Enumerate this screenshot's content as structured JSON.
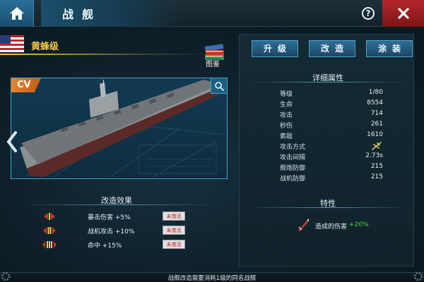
{
  "header": {
    "title": "战舰"
  },
  "ship": {
    "name": "黄蜂级",
    "class_badge": "CV",
    "catalog_label": "图鉴"
  },
  "modification": {
    "title": "改造效果",
    "rows": [
      {
        "icon": "rank-1-icon",
        "text": "暴击伤害  +5%",
        "status": "未激活"
      },
      {
        "icon": "rank-2-icon",
        "text": "战机攻击  +10%",
        "status": "未激活"
      },
      {
        "icon": "rank-3-icon",
        "text": "命中  +15%",
        "status": "未激活"
      }
    ]
  },
  "actions": {
    "upgrade": "升级",
    "modify": "改造",
    "paint": "涂装"
  },
  "stats": {
    "title": "详细属性",
    "rows": [
      {
        "label": "等级",
        "value": "1/80"
      },
      {
        "label": "生命",
        "value": "8554"
      },
      {
        "label": "攻击",
        "value": "714"
      },
      {
        "label": "秒伤",
        "value": "261"
      },
      {
        "label": "索敌",
        "value": "1610"
      },
      {
        "label": "攻击方式",
        "value": "",
        "icon": "aircraft-icon"
      },
      {
        "label": "攻击间隔",
        "value": "2.73s"
      },
      {
        "label": "舰炮防御",
        "value": "215"
      },
      {
        "label": "战机防御",
        "value": "215"
      }
    ]
  },
  "traits": {
    "title": "特性",
    "items": [
      {
        "icon": "damage-icon",
        "label": "造成的伤害",
        "value": "+20%"
      }
    ]
  },
  "footer": {
    "text": "战舰改造需要消耗1级的同名战舰"
  },
  "colors": {
    "accent": "#3fa3c9",
    "name_gold": "#f1c94a",
    "close_red": "#b3262a",
    "positive_green": "#4fd44a",
    "inactive_red": "#b51f1f"
  }
}
